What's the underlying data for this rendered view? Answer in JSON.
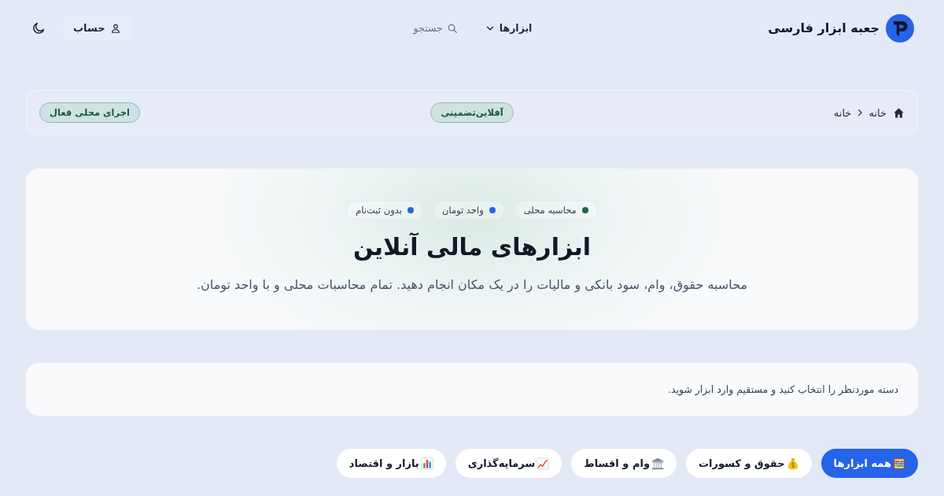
{
  "header": {
    "brand": "جعبه ابزار فارسی",
    "nav": [
      {
        "kind": "dropdown",
        "label": "ابزارها"
      },
      {
        "kind": "search",
        "label": "جستجو"
      }
    ],
    "account": "حساب"
  },
  "breadcrumb": {
    "items": [
      "خانه",
      "خانه"
    ],
    "badges": [
      "آفلاین‌تضمینی",
      "اجرای محلی فعال"
    ]
  },
  "hero": {
    "features": [
      {
        "label": "محاسبه محلی",
        "color": "#166a4a"
      },
      {
        "label": "واحد تومان",
        "color": "#2563eb"
      },
      {
        "label": "بدون ثبت‌نام",
        "color": "#2563eb"
      }
    ],
    "title": "ابزارهای مالی آنلاین",
    "description": "محاسبه حقوق، وام، سود بانکی و مالیات را در یک مکان انجام دهید. تمام محاسبات محلی و با واحد تومان."
  },
  "info": "دسته موردنظر را انتخاب کنید و مستقیم وارد ابزار شوید.",
  "categories": [
    {
      "kind": "all",
      "label": "همه ابزارها",
      "selected": true
    },
    {
      "kind": "salary",
      "label": "حقوق و کسورات",
      "selected": false
    },
    {
      "kind": "loan",
      "label": "وام و اقساط",
      "selected": false
    },
    {
      "kind": "investment",
      "label": "سرمایه‌گذاری",
      "selected": false
    },
    {
      "kind": "market",
      "label": "بازار و اقتصاد",
      "selected": false
    }
  ]
}
